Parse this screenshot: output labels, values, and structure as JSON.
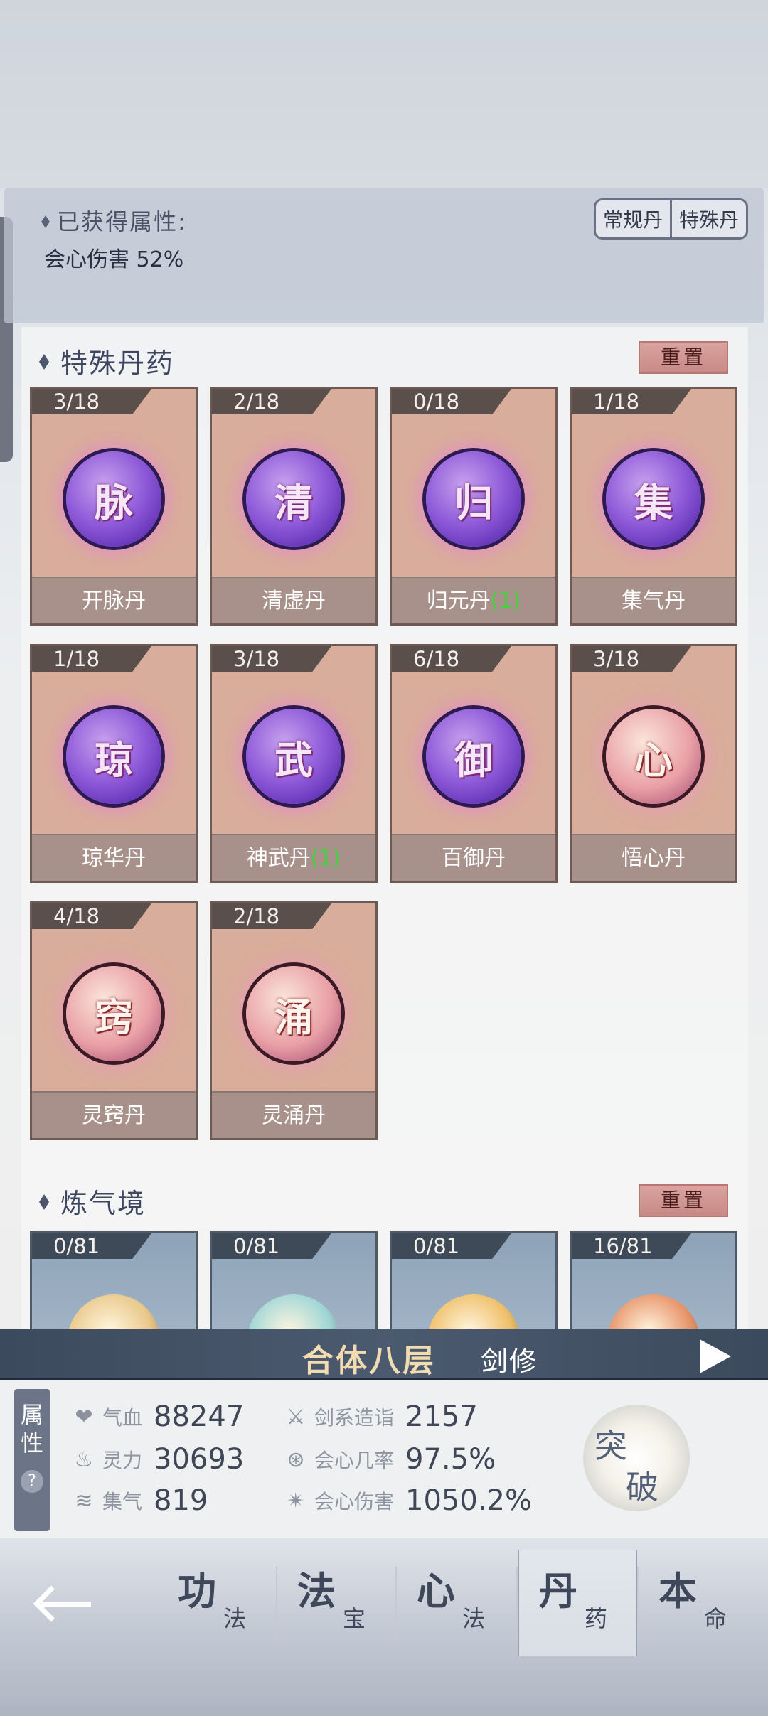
{
  "header": {
    "attr_title": "已获得属性:",
    "attr_value": "会心伤害 52%",
    "toggle": [
      "常规丹",
      "特殊丹"
    ]
  },
  "special": {
    "title": "特殊丹药",
    "reset": "重置",
    "items": [
      {
        "count": "3/18",
        "glyph": "脉",
        "name": "开脉丹",
        "bonus": "",
        "style": "purple"
      },
      {
        "count": "2/18",
        "glyph": "清",
        "name": "清虚丹",
        "bonus": "",
        "style": "purple"
      },
      {
        "count": "0/18",
        "glyph": "归",
        "name": "归元丹",
        "bonus": "(1)",
        "style": "purple"
      },
      {
        "count": "1/18",
        "glyph": "集",
        "name": "集气丹",
        "bonus": "",
        "style": "purple"
      },
      {
        "count": "1/18",
        "glyph": "琼",
        "name": "琼华丹",
        "bonus": "",
        "style": "purple"
      },
      {
        "count": "3/18",
        "glyph": "武",
        "name": "神武丹",
        "bonus": "(1)",
        "style": "purple"
      },
      {
        "count": "6/18",
        "glyph": "御",
        "name": "百御丹",
        "bonus": "",
        "style": "purple"
      },
      {
        "count": "3/18",
        "glyph": "心",
        "name": "悟心丹",
        "bonus": "",
        "style": "pink"
      },
      {
        "count": "4/18",
        "glyph": "窍",
        "name": "灵窍丹",
        "bonus": "",
        "style": "pink"
      },
      {
        "count": "2/18",
        "glyph": "涌",
        "name": "灵涌丹",
        "bonus": "",
        "style": "pink"
      }
    ]
  },
  "qi": {
    "title": "炼气境",
    "reset": "重置",
    "items": [
      {
        "count": "0/81",
        "orb": "#e9c88a"
      },
      {
        "count": "0/81",
        "orb": "#9fd6d6"
      },
      {
        "count": "0/81",
        "orb": "#efc06a"
      },
      {
        "count": "16/81",
        "orb": "#e8946a"
      }
    ]
  },
  "realm": {
    "level": "合体八层",
    "class": "剑修"
  },
  "stats": {
    "tab_label": "属性",
    "help": "?",
    "items": [
      {
        "icon": "heart-icon",
        "glyph": "❤",
        "label": "气血",
        "value": "88247"
      },
      {
        "icon": "spirit-flame-icon",
        "glyph": "♨",
        "label": "灵力",
        "value": "30693"
      },
      {
        "icon": "swirl-icon",
        "glyph": "≋",
        "label": "集气",
        "value": "819"
      },
      {
        "icon": "sword-icon",
        "glyph": "⚔",
        "label": "剑系造诣",
        "value": "2157"
      },
      {
        "icon": "crit-rate-icon",
        "glyph": "⊛",
        "label": "会心几率",
        "value": "97.5%"
      },
      {
        "icon": "crit-damage-icon",
        "glyph": "✴",
        "label": "会心伤害",
        "value": "1050.2%"
      }
    ],
    "breakthrough": [
      "突",
      "破"
    ]
  },
  "nav": {
    "items": [
      {
        "big": "功",
        "small": "法"
      },
      {
        "big": "法",
        "small": "宝"
      },
      {
        "big": "心",
        "small": "法"
      },
      {
        "big": "丹",
        "small": "药"
      },
      {
        "big": "本",
        "small": "命"
      }
    ],
    "active_index": 3
  }
}
